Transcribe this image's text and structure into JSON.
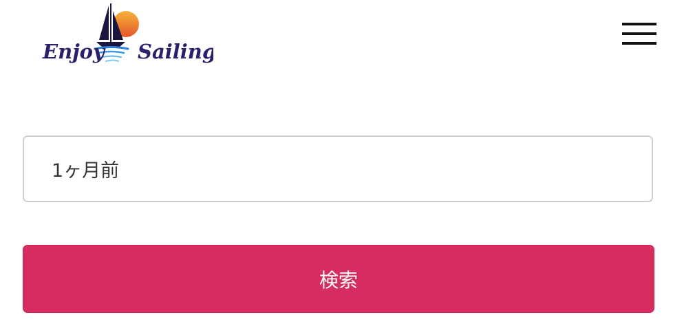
{
  "header": {
    "logo": {
      "word_left": "Enjoy",
      "word_right": "Sailing",
      "brand_color": "#2a1f6b",
      "sun_color": "#f39a1a",
      "sea_color": "#2f7fd6"
    },
    "menu_icon": "hamburger-menu-icon"
  },
  "form": {
    "period_value": "1ヶ月前",
    "search_label": "検索",
    "button_color": "#d72c5f"
  }
}
